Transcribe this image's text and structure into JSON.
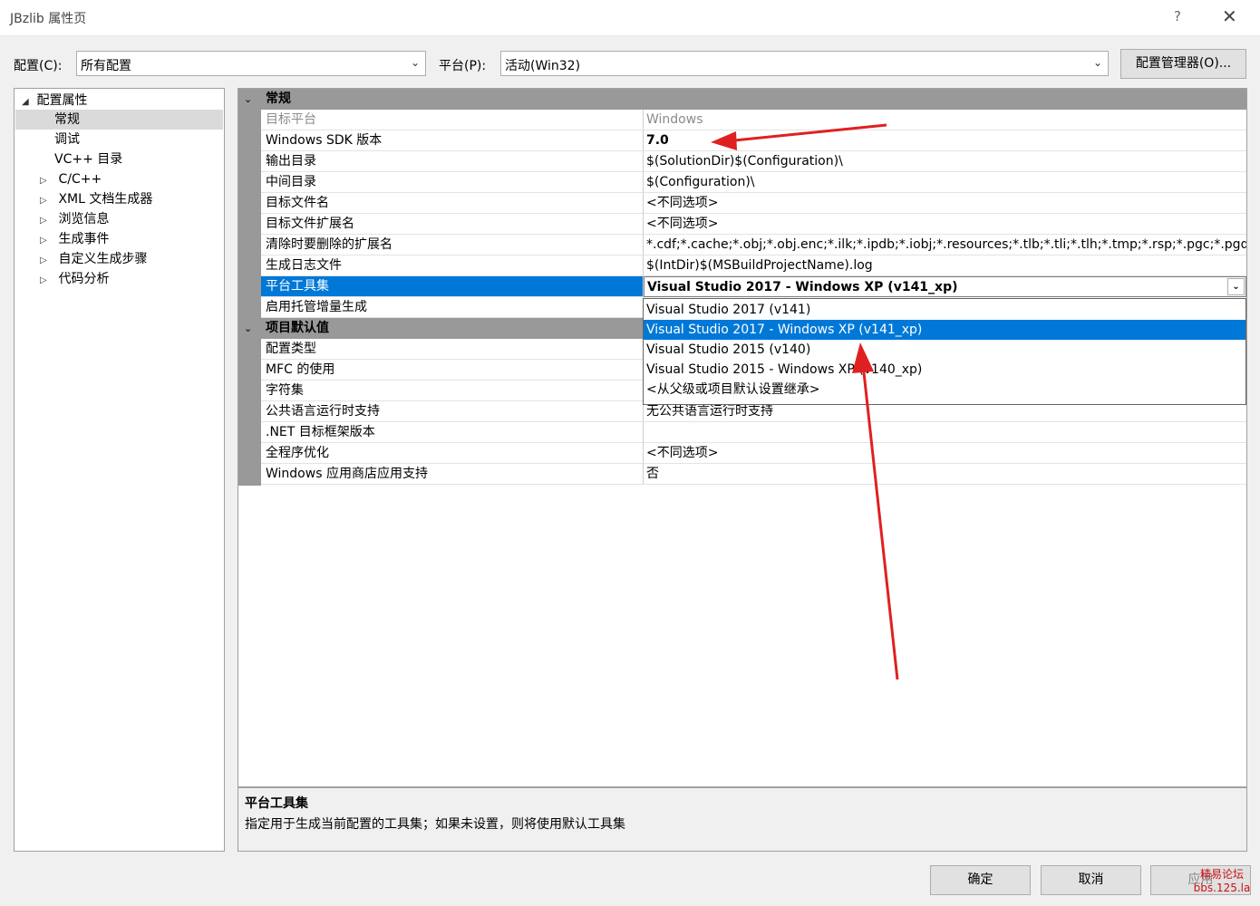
{
  "window": {
    "title": "JBzlib 属性页",
    "help": "?",
    "close": "✕"
  },
  "toolbar": {
    "config_label": "配置(C):",
    "config_value": "所有配置",
    "platform_label": "平台(P):",
    "platform_value": "活动(Win32)",
    "manager_button": "配置管理器(O)..."
  },
  "tree": {
    "root": {
      "toggle": "◢",
      "label": "配置属性"
    },
    "items": [
      {
        "toggle": "",
        "label": "常规"
      },
      {
        "toggle": "",
        "label": "调试"
      },
      {
        "toggle": "",
        "label": "VC++ 目录"
      },
      {
        "toggle": "▷",
        "label": "C/C++"
      },
      {
        "toggle": "▷",
        "label": "XML 文档生成器"
      },
      {
        "toggle": "▷",
        "label": "浏览信息"
      },
      {
        "toggle": "▷",
        "label": "生成事件"
      },
      {
        "toggle": "▷",
        "label": "自定义生成步骤"
      },
      {
        "toggle": "▷",
        "label": "代码分析"
      }
    ]
  },
  "grid": {
    "categories": [
      {
        "toggle": "⌄",
        "title": "常规"
      },
      {
        "toggle": "⌄",
        "title": "项目默认值"
      }
    ],
    "general_rows": [
      {
        "name": "目标平台",
        "value": "Windows"
      },
      {
        "name": "Windows SDK 版本",
        "value": "7.0"
      },
      {
        "name": "输出目录",
        "value": "$(SolutionDir)$(Configuration)\\"
      },
      {
        "name": "中间目录",
        "value": "$(Configuration)\\"
      },
      {
        "name": "目标文件名",
        "value": "<不同选项>"
      },
      {
        "name": "目标文件扩展名",
        "value": "<不同选项>"
      },
      {
        "name": "清除时要删除的扩展名",
        "value": "*.cdf;*.cache;*.obj;*.obj.enc;*.ilk;*.ipdb;*.iobj;*.resources;*.tlb;*.tli;*.tlh;*.tmp;*.rsp;*.pgc;*.pgd"
      },
      {
        "name": "生成日志文件",
        "value": "$(IntDir)$(MSBuildProjectName).log"
      },
      {
        "name": "平台工具集",
        "value": "Visual Studio 2017 - Windows XP (v141_xp)"
      },
      {
        "name": "启用托管增量生成",
        "value": ""
      }
    ],
    "defaults_rows": [
      {
        "name": "配置类型",
        "value": ""
      },
      {
        "name": "MFC 的使用",
        "value": ""
      },
      {
        "name": "字符集",
        "value": ""
      },
      {
        "name": "公共语言运行时支持",
        "value": "无公共语言运行时支持"
      },
      {
        "name": ".NET 目标框架版本",
        "value": ""
      },
      {
        "name": "全程序优化",
        "value": "<不同选项>"
      },
      {
        "name": "Windows 应用商店应用支持",
        "value": "否"
      }
    ],
    "dropdown_arrow": "⌄",
    "toolset_options": [
      "Visual Studio 2017 (v141)",
      "Visual Studio 2017 - Windows XP (v141_xp)",
      "Visual Studio 2015 (v140)",
      "Visual Studio 2015 - Windows XP (v140_xp)",
      "<从父级或项目默认设置继承>"
    ],
    "highlighted_option": "Visual Studio 2017 - Windows XP (v141_xp)"
  },
  "description": {
    "title": "平台工具集",
    "text": "指定用于生成当前配置的工具集；如果未设置，则将使用默认工具集"
  },
  "buttons": {
    "ok": "确定",
    "cancel": "取消",
    "apply": "应用"
  },
  "watermark": {
    "line1": "精易论坛",
    "line2": "bbs.125.la"
  },
  "colors": {
    "selection": "#0078d7",
    "category": "#999999",
    "annotation": "#e02020"
  }
}
